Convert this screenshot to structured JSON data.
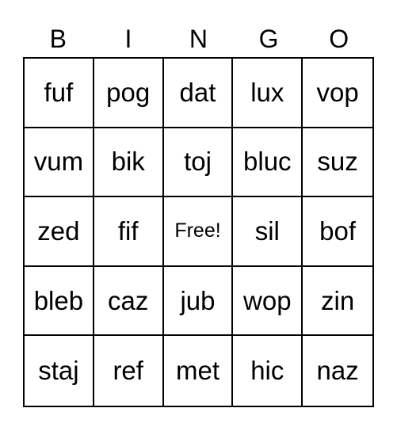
{
  "header": [
    "B",
    "I",
    "N",
    "G",
    "O"
  ],
  "board": [
    [
      "fuf",
      "pog",
      "dat",
      "lux",
      "vop"
    ],
    [
      "vum",
      "bik",
      "toj",
      "bluc",
      "suz"
    ],
    [
      "zed",
      "fif",
      "Free!",
      "sil",
      "bof"
    ],
    [
      "bleb",
      "caz",
      "jub",
      "wop",
      "zin"
    ],
    [
      "staj",
      "ref",
      "met",
      "hic",
      "naz"
    ]
  ]
}
